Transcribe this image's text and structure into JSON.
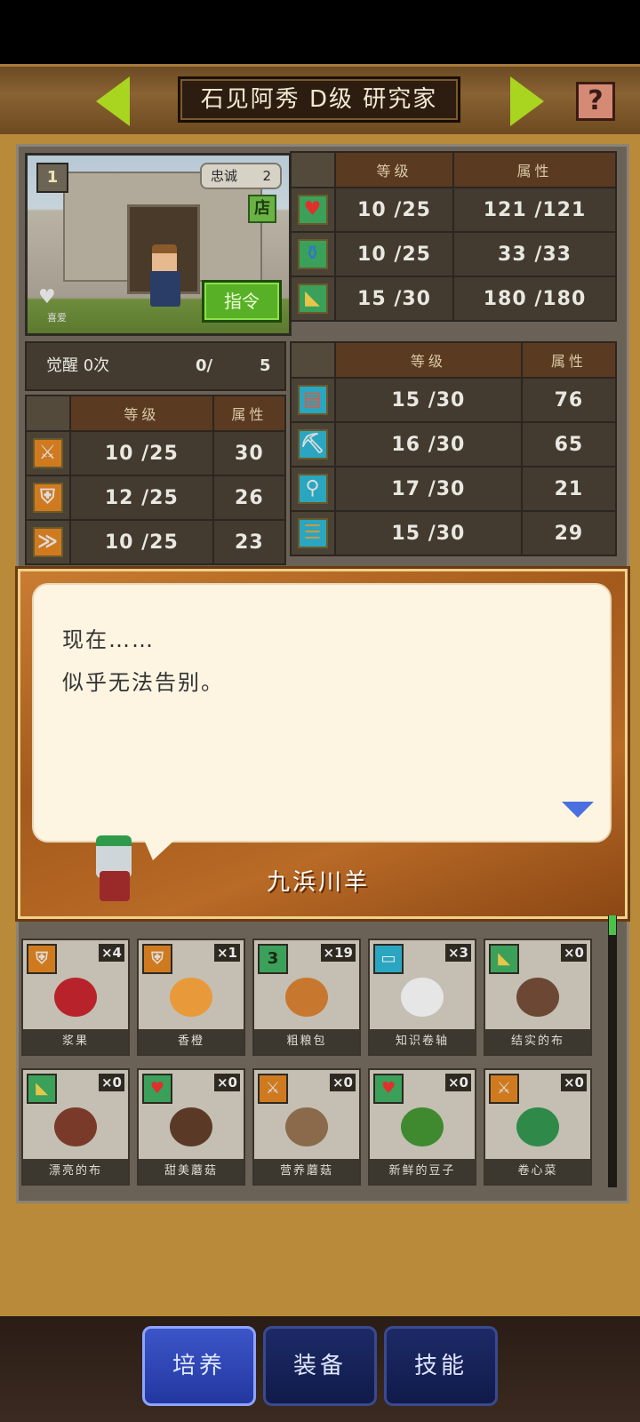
{
  "header": {
    "title": "石见阿秀 D级 研究家",
    "help_icon": "?"
  },
  "portrait": {
    "level_icon": "1",
    "loyalty_label": "忠诚",
    "loyalty_value": "2",
    "shop_label": "店",
    "command_label": "指令",
    "hobby_label": "喜爱"
  },
  "stats_top": {
    "col_level": "等级",
    "col_attr": "属性",
    "rows": [
      {
        "icon": "heart-icon",
        "level": "10 /25",
        "value": "121 /121"
      },
      {
        "icon": "potion-icon",
        "level": "10 /25",
        "value": "33 /33"
      },
      {
        "icon": "arm-icon",
        "level": "15 /30",
        "value": "180 /180"
      }
    ]
  },
  "awaken": {
    "label": "觉醒 0次",
    "current": "0/",
    "max": "5"
  },
  "stats_left": {
    "col_level": "等级",
    "col_attr": "属性",
    "rows": [
      {
        "icon": "sword-icon",
        "level": "10 /25",
        "value": "30"
      },
      {
        "icon": "shield-icon",
        "level": "12 /25",
        "value": "26"
      },
      {
        "icon": "speed-icon",
        "level": "10 /25",
        "value": "23"
      }
    ]
  },
  "stats_mid": {
    "col_level": "等级",
    "col_attr": "属性",
    "rows": [
      {
        "icon": "book-icon",
        "level": "15 /30",
        "value": "76"
      },
      {
        "icon": "pickaxe-icon",
        "level": "16 /30",
        "value": "65"
      },
      {
        "icon": "shovel-icon",
        "level": "17 /30",
        "value": "21"
      },
      {
        "icon": "craft-icon",
        "level": "15 /30",
        "value": "29"
      }
    ]
  },
  "dialog": {
    "line1": "现在……",
    "line2": "似乎无法告别。",
    "speaker": "九浜川羊"
  },
  "items": [
    {
      "name": "浆果",
      "tag": "shield",
      "count": "×4",
      "color": "#b8232b"
    },
    {
      "name": "香橙",
      "tag": "shield",
      "count": "×1",
      "color": "#e89a3a"
    },
    {
      "name": "粗粮包",
      "tag": "3",
      "count": "×19",
      "color": "#c7782e"
    },
    {
      "name": "知识卷轴",
      "tag": "scroll",
      "count": "×3",
      "color": "#e6e6e6"
    },
    {
      "name": "结实的布",
      "tag": "arm",
      "count": "×0",
      "color": "#6b4734"
    },
    {
      "name": "漂亮的布",
      "tag": "arm",
      "count": "×0",
      "color": "#7a3a2a"
    },
    {
      "name": "甜美蘑菇",
      "tag": "heart",
      "count": "×0",
      "color": "#5a3a26"
    },
    {
      "name": "营养蘑菇",
      "tag": "sword",
      "count": "×0",
      "color": "#8a6a4a"
    },
    {
      "name": "新鲜的豆子",
      "tag": "heart",
      "count": "×0",
      "color": "#3f8a2e"
    },
    {
      "name": "卷心菜",
      "tag": "sword",
      "count": "×0",
      "color": "#2f8a4a"
    }
  ],
  "nav": {
    "train": "培养",
    "equip": "装备",
    "skill": "技能"
  },
  "colors": {
    "accent_green": "#a9d420",
    "nav_active": "#3c55c8",
    "attr_value": "#9be3c7"
  }
}
